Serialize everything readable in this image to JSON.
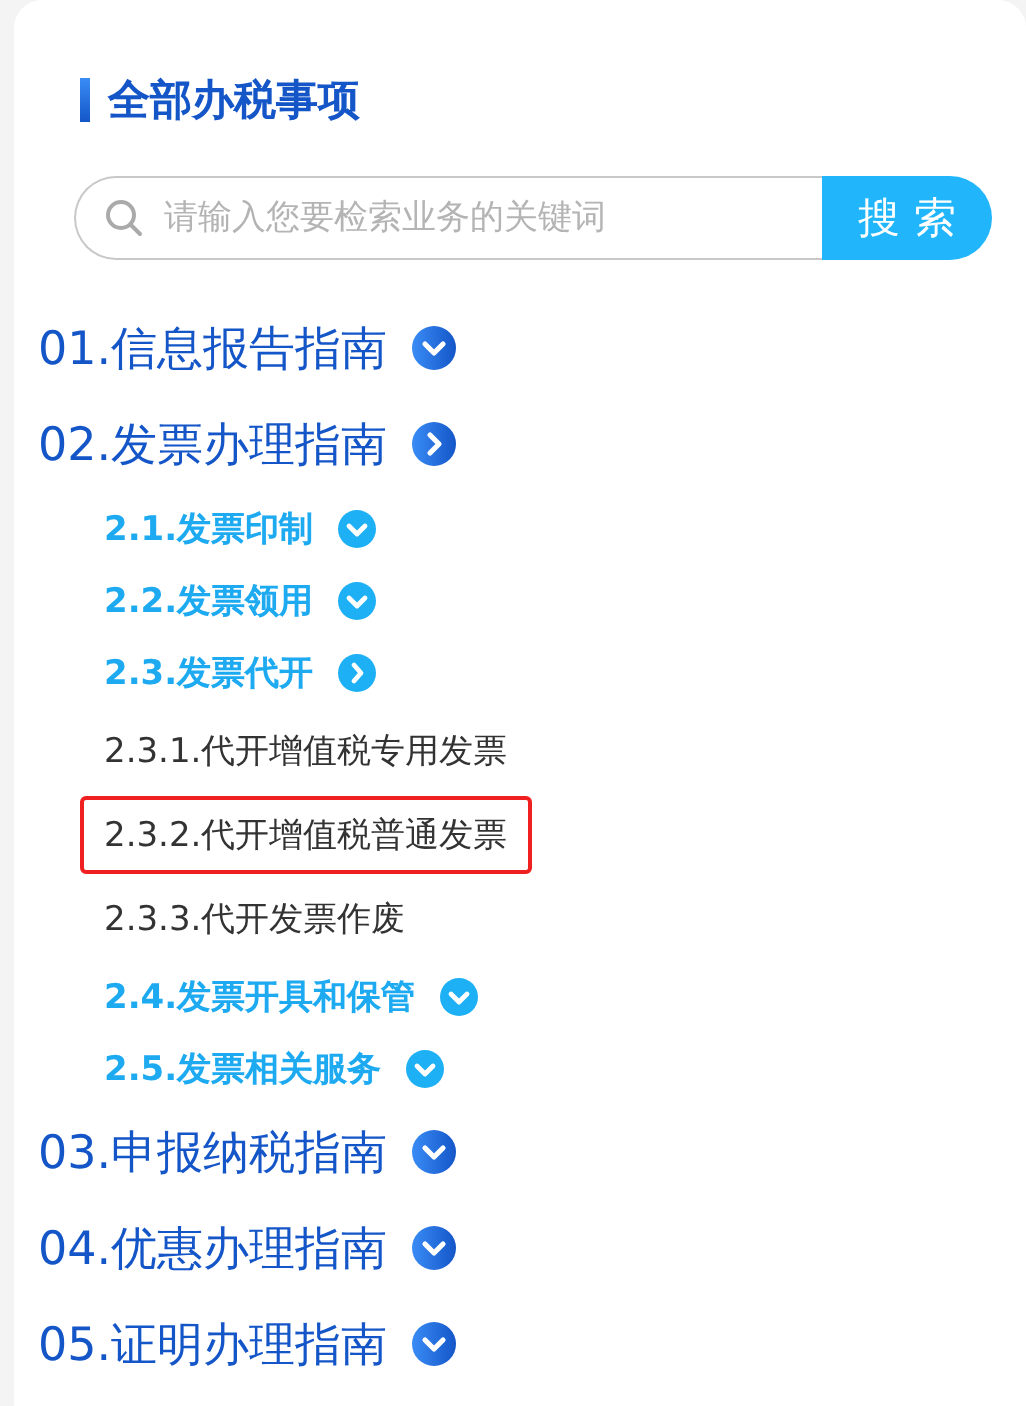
{
  "title": "全部办税事项",
  "search": {
    "placeholder": "请输入您要检索业务的关键词",
    "button": "搜 索"
  },
  "items": [
    {
      "label": "01.信息报告指南",
      "expanded": false
    },
    {
      "label": "02.发票办理指南",
      "expanded": true,
      "children": [
        {
          "label": "2.1.发票印制",
          "expanded": false
        },
        {
          "label": "2.2.发票领用",
          "expanded": false
        },
        {
          "label": "2.3.发票代开",
          "expanded": true,
          "children": [
            {
              "label": "2.3.1.代开增值税专用发票",
              "selected": false
            },
            {
              "label": "2.3.2.代开增值税普通发票",
              "selected": true
            },
            {
              "label": "2.3.3.代开发票作废",
              "selected": false
            }
          ]
        },
        {
          "label": "2.4.发票开具和保管",
          "expanded": false
        },
        {
          "label": "2.5.发票相关服务",
          "expanded": false
        }
      ]
    },
    {
      "label": "03.申报纳税指南",
      "expanded": false
    },
    {
      "label": "04.优惠办理指南",
      "expanded": false
    },
    {
      "label": "05.证明办理指南",
      "expanded": false
    }
  ]
}
